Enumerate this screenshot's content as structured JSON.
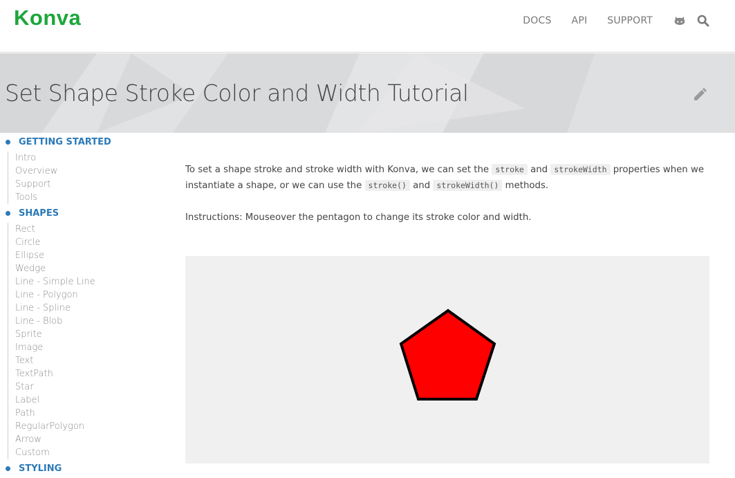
{
  "brand": {
    "name": "Konva"
  },
  "nav": {
    "docs": "DOCS",
    "api": "API",
    "support": "SUPPORT",
    "github_icon": "github-icon",
    "search_icon": "search-icon"
  },
  "hero": {
    "title": "Set Shape Stroke Color and Width Tutorial",
    "edit_icon": "pencil-icon"
  },
  "sidebar": {
    "getting_started": {
      "title": "GETTING STARTED",
      "items": [
        "Intro",
        "Overview",
        "Support",
        "Tools"
      ]
    },
    "shapes": {
      "title": "SHAPES",
      "items": [
        "Rect",
        "Circle",
        "Ellipse",
        "Wedge",
        "Line - Simple Line",
        "Line - Polygon",
        "Line - Spline",
        "Line - Blob",
        "Sprite",
        "Image",
        "Text",
        "TextPath",
        "Star",
        "Label",
        "Path",
        "RegularPolygon",
        "Arrow",
        "Custom"
      ]
    },
    "styling": {
      "title": "STYLING"
    }
  },
  "content": {
    "p1": {
      "t1": "To set a shape stroke and stroke width with Konva, we can set the ",
      "c1": "stroke",
      "t2": " and ",
      "c2": "strokeWidth",
      "t3": " properties when we instantiate a shape, or we can use the ",
      "c3": "stroke()",
      "t4": " and ",
      "c4": "strokeWidth()",
      "t5": " methods."
    },
    "p2": "Instructions: Mouseover the pentagon to change its stroke color and width."
  },
  "demo": {
    "fill": "#ff0000",
    "stroke": "#000000",
    "background": "#f0f0f0"
  },
  "colors": {
    "brand": "#1ca63a",
    "section": "#2b7ab8",
    "nav_text": "#777777"
  }
}
